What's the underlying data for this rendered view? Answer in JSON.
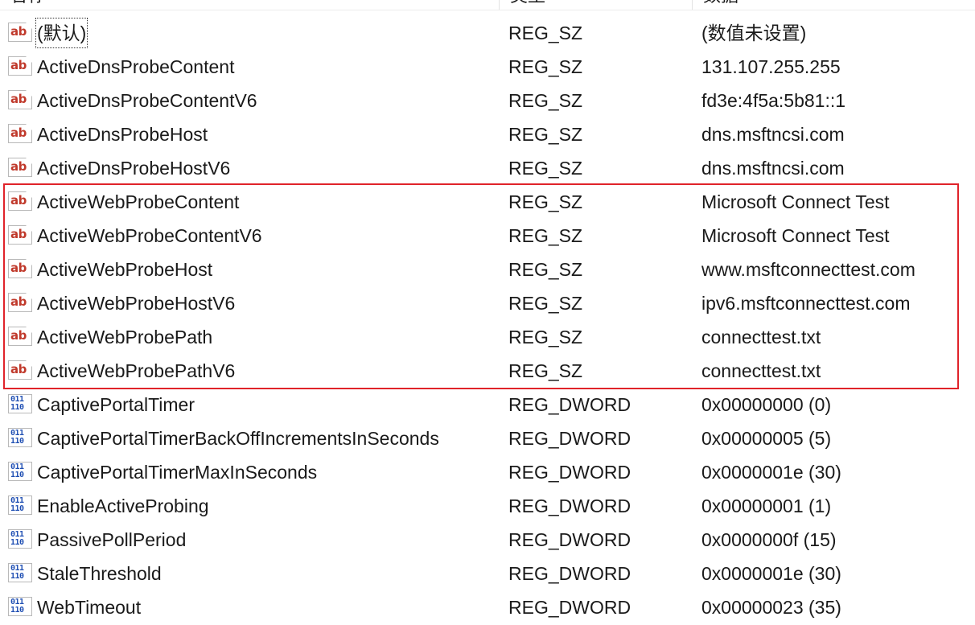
{
  "columns": {
    "name": "名称",
    "type": "类型",
    "data": "数据"
  },
  "icons": {
    "string": "ab",
    "dword": "011\n110"
  },
  "highlight_color": "#e0232a",
  "rows": [
    {
      "icon": "string-value-icon",
      "name": "(默认)",
      "type": "REG_SZ",
      "data": "(数值未设置)"
    },
    {
      "icon": "string-value-icon",
      "name": "ActiveDnsProbeContent",
      "type": "REG_SZ",
      "data": "131.107.255.255"
    },
    {
      "icon": "string-value-icon",
      "name": "ActiveDnsProbeContentV6",
      "type": "REG_SZ",
      "data": "fd3e:4f5a:5b81::1"
    },
    {
      "icon": "string-value-icon",
      "name": "ActiveDnsProbeHost",
      "type": "REG_SZ",
      "data": "dns.msftncsi.com"
    },
    {
      "icon": "string-value-icon",
      "name": "ActiveDnsProbeHostV6",
      "type": "REG_SZ",
      "data": "dns.msftncsi.com"
    },
    {
      "icon": "string-value-icon",
      "name": "ActiveWebProbeContent",
      "type": "REG_SZ",
      "data": "Microsoft Connect Test"
    },
    {
      "icon": "string-value-icon",
      "name": "ActiveWebProbeContentV6",
      "type": "REG_SZ",
      "data": "Microsoft Connect Test"
    },
    {
      "icon": "string-value-icon",
      "name": "ActiveWebProbeHost",
      "type": "REG_SZ",
      "data": "www.msftconnecttest.com"
    },
    {
      "icon": "string-value-icon",
      "name": "ActiveWebProbeHostV6",
      "type": "REG_SZ",
      "data": "ipv6.msftconnecttest.com"
    },
    {
      "icon": "string-value-icon",
      "name": "ActiveWebProbePath",
      "type": "REG_SZ",
      "data": "connecttest.txt"
    },
    {
      "icon": "string-value-icon",
      "name": "ActiveWebProbePathV6",
      "type": "REG_SZ",
      "data": "connecttest.txt"
    },
    {
      "icon": "dword-value-icon",
      "name": "CaptivePortalTimer",
      "type": "REG_DWORD",
      "data": "0x00000000 (0)"
    },
    {
      "icon": "dword-value-icon",
      "name": "CaptivePortalTimerBackOffIncrementsInSeconds",
      "type": "REG_DWORD",
      "data": "0x00000005 (5)"
    },
    {
      "icon": "dword-value-icon",
      "name": "CaptivePortalTimerMaxInSeconds",
      "type": "REG_DWORD",
      "data": "0x0000001e (30)"
    },
    {
      "icon": "dword-value-icon",
      "name": "EnableActiveProbing",
      "type": "REG_DWORD",
      "data": "0x00000001 (1)"
    },
    {
      "icon": "dword-value-icon",
      "name": "PassivePollPeriod",
      "type": "REG_DWORD",
      "data": "0x0000000f (15)"
    },
    {
      "icon": "dword-value-icon",
      "name": "StaleThreshold",
      "type": "REG_DWORD",
      "data": "0x0000001e (30)"
    },
    {
      "icon": "dword-value-icon",
      "name": "WebTimeout",
      "type": "REG_DWORD",
      "data": "0x00000023 (35)"
    }
  ]
}
